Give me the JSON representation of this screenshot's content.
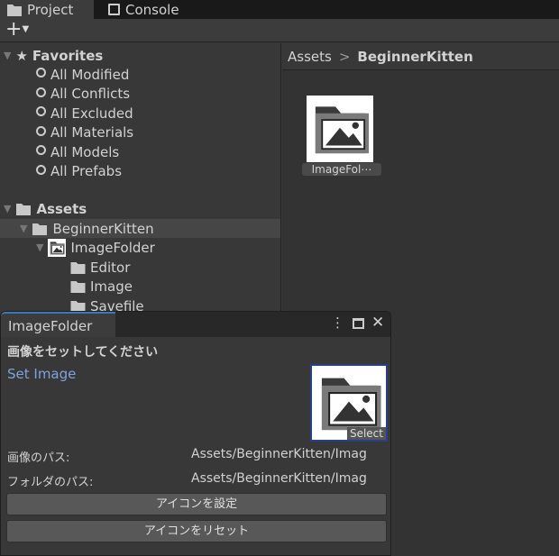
{
  "tabs": [
    {
      "label": "Project",
      "icon": "folder-icon"
    },
    {
      "label": "Console",
      "icon": "console-icon"
    }
  ],
  "toolbar": {
    "add": "+"
  },
  "favorites": {
    "label": "Favorites",
    "items": [
      "All Modified",
      "All Conflicts",
      "All Excluded",
      "All Materials",
      "All Models",
      "All Prefabs"
    ]
  },
  "assets": {
    "label": "Assets",
    "children": [
      {
        "label": "BeginnerKitten"
      },
      {
        "label": "ImageFolder"
      },
      {
        "label": "Editor"
      },
      {
        "label": "Image"
      },
      {
        "label": "Savefile"
      }
    ]
  },
  "breadcrumb": {
    "root": "Assets",
    "sep": ">",
    "current": "BeginnerKitten"
  },
  "grid": {
    "item": "ImageFol⋯"
  },
  "window": {
    "title": "ImageFolder",
    "heading": "画像をセットしてください",
    "set_image": "Set Image",
    "select": "Select",
    "image_path_label": "画像のパス:",
    "image_path": "Assets/BeginnerKitten/Imag",
    "folder_path_label": "フォルダのパス:",
    "folder_path": "Assets/BeginnerKitten/Imag",
    "set_icon": "アイコンを設定",
    "reset_icon": "アイコンをリセット"
  }
}
